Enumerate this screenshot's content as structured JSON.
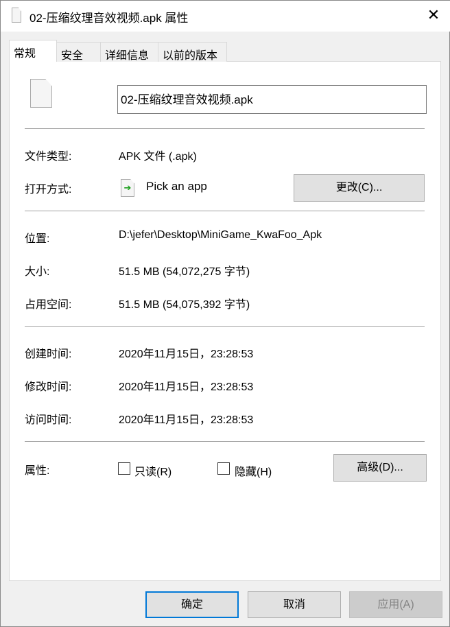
{
  "window": {
    "title": "02-压缩纹理音效视频.apk 属性",
    "close_icon": "close-icon"
  },
  "tabs": [
    "常规",
    "安全",
    "详细信息",
    "以前的版本"
  ],
  "general": {
    "filename": "02-压缩纹理音效视频.apk",
    "type_label": "文件类型:",
    "type_value": "APK 文件 (.apk)",
    "opens_label": "打开方式:",
    "opens_value": "Pick an app",
    "change_button": "更改(C)...",
    "location_label": "位置:",
    "location_value": "D:\\jefer\\Desktop\\MiniGame_KwaFoo_Apk",
    "size_label": "大小:",
    "size_value": "51.5 MB (54,072,275 字节)",
    "disk_label": "占用空间:",
    "disk_value": "51.5 MB (54,075,392 字节)",
    "created_label": "创建时间:",
    "created_value": "2020年11月15日，23:28:53",
    "modified_label": "修改时间:",
    "modified_value": "2020年11月15日，23:28:53",
    "accessed_label": "访问时间:",
    "accessed_value": "2020年11月15日，23:28:53",
    "attributes_label": "属性:",
    "readonly_label": "只读(R)",
    "readonly_checked": false,
    "hidden_label": "隐藏(H)",
    "hidden_checked": false,
    "advanced_button": "高级(D)..."
  },
  "footer": {
    "ok": "确定",
    "cancel": "取消",
    "apply": "应用(A)"
  }
}
